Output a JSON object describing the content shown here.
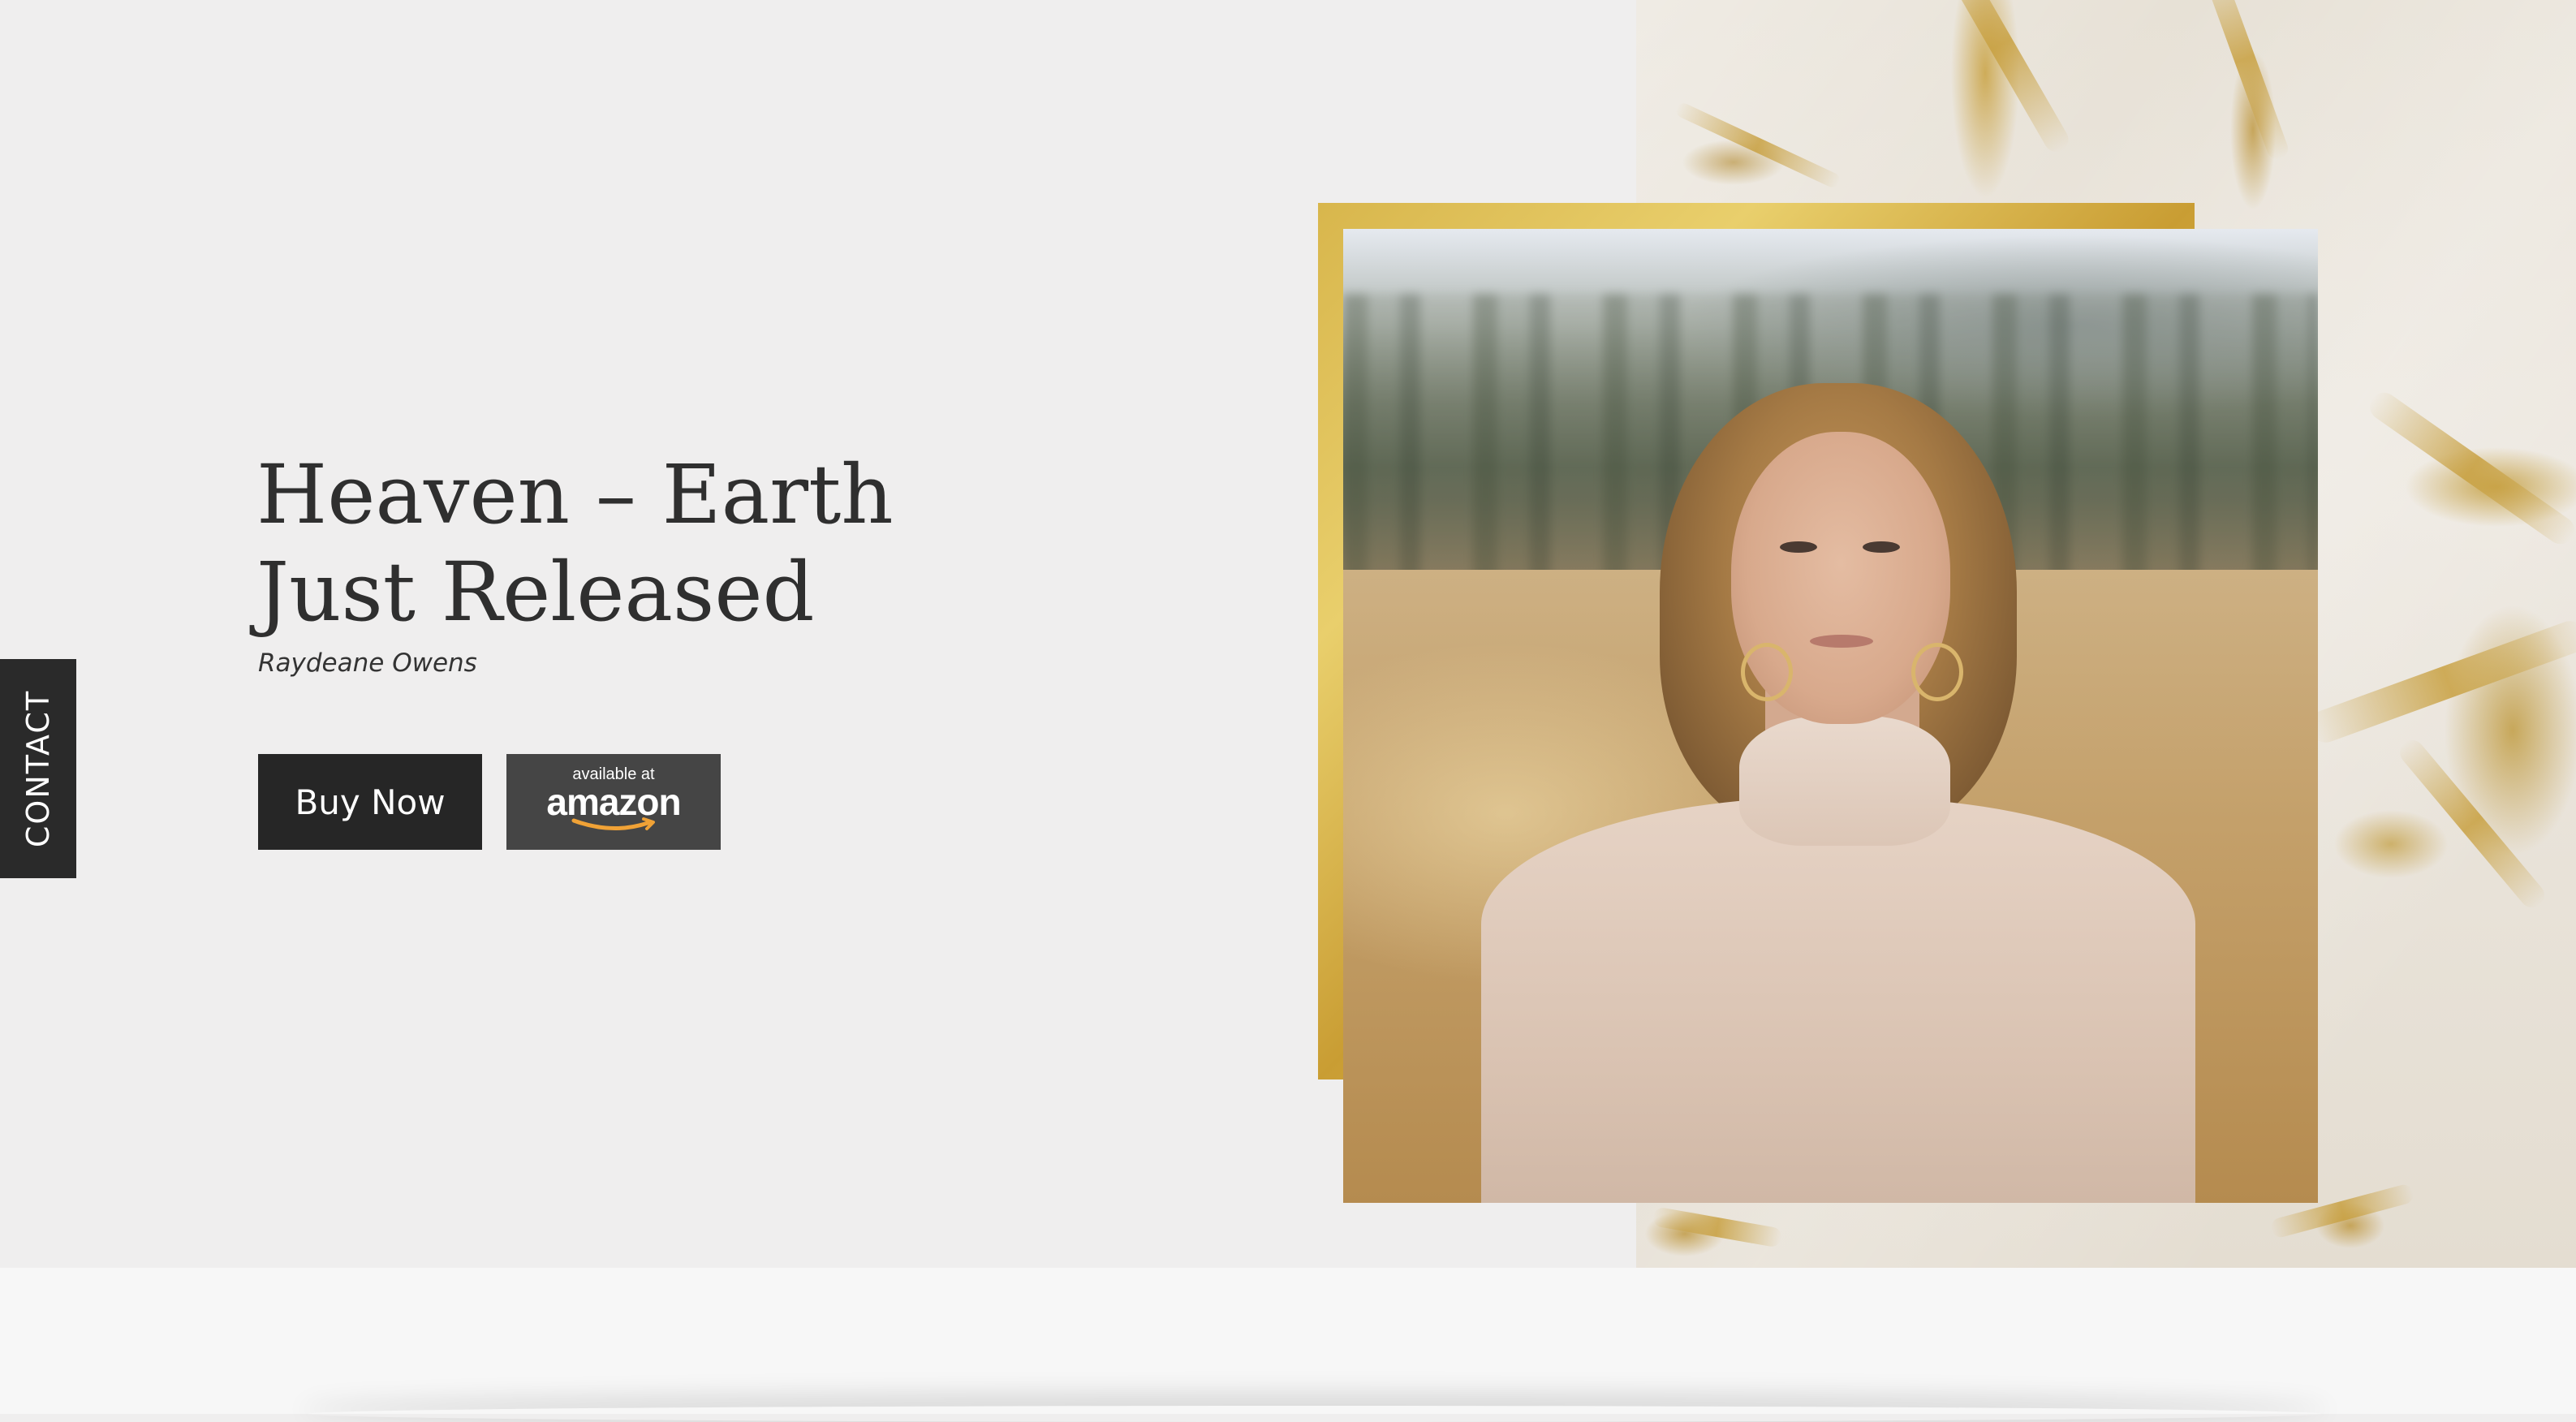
{
  "hero": {
    "title_line1": "Heaven – Earth",
    "title_line2": "Just Released",
    "author": "Raydeane Owens",
    "buy_button_label": "Buy Now",
    "amazon_badge": {
      "top_text": "available at",
      "brand_text": "amazon"
    }
  },
  "side_tab": {
    "label": "CONTACT"
  },
  "colors": {
    "background": "#efeeee",
    "dark_button": "#262626",
    "amazon_button": "#454545",
    "gold_frame": "#d8b64c",
    "amazon_smile": "#f0a236"
  },
  "images": {
    "portrait": "woman-in-field-photo",
    "background_texture": "gold-marble-texture"
  }
}
